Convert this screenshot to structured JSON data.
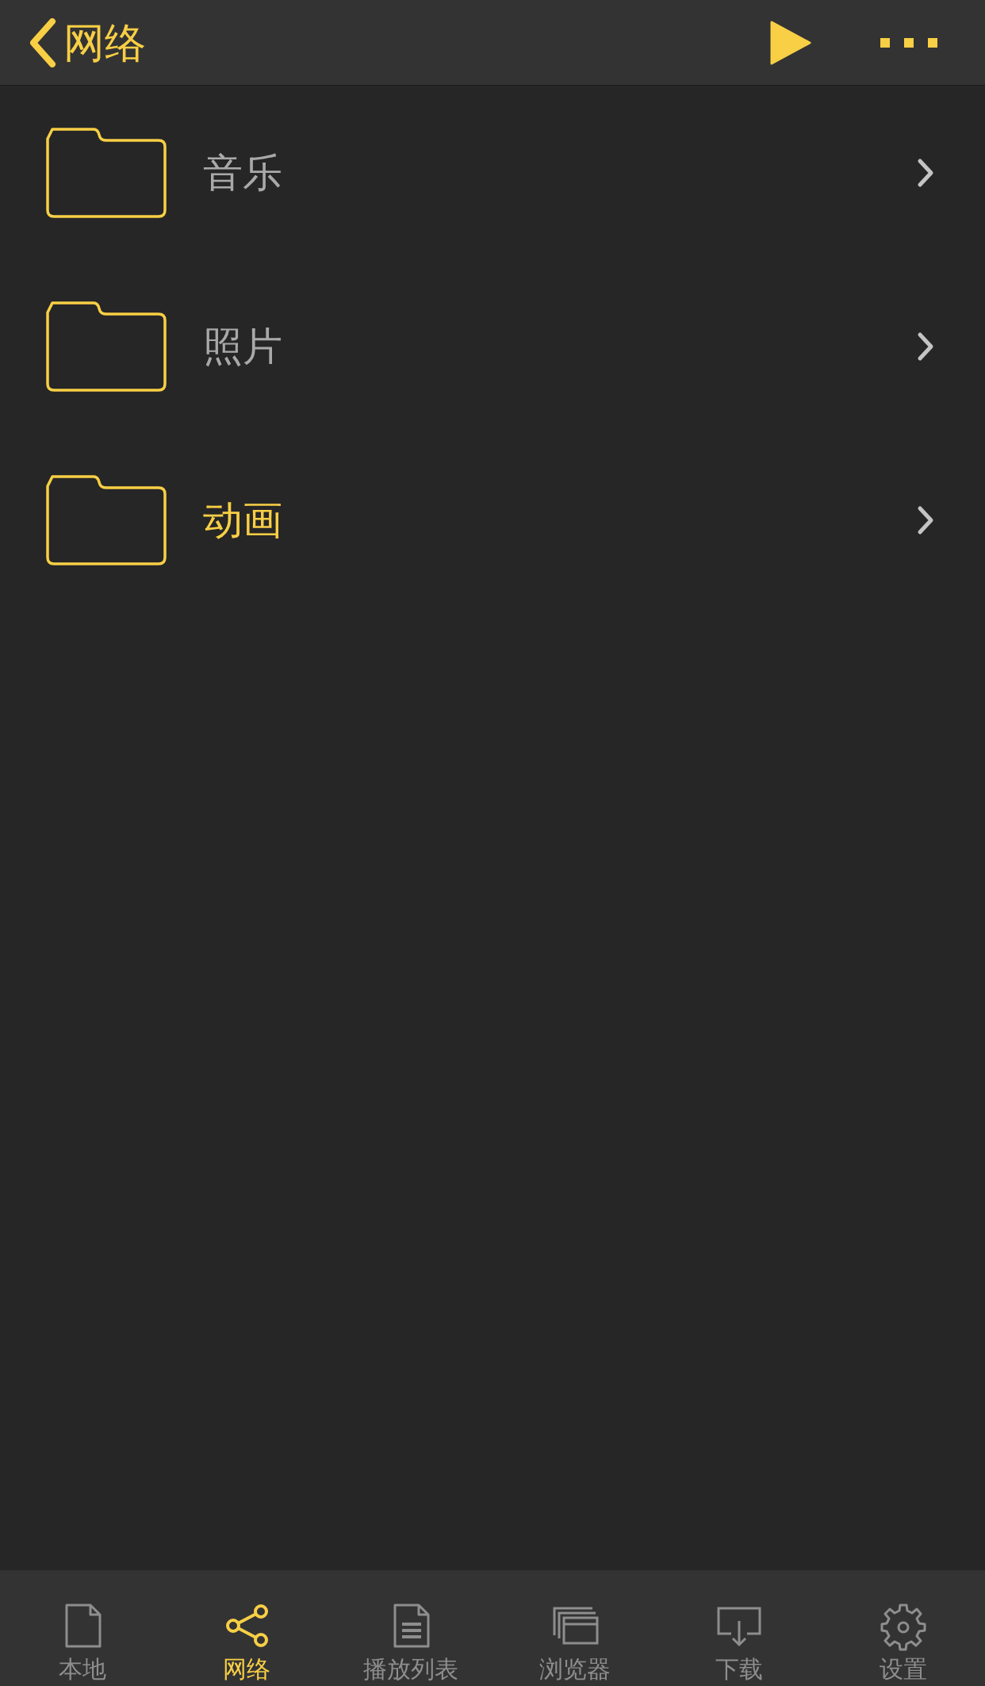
{
  "nav_bar": {
    "back_label": "网络"
  },
  "folders": [
    {
      "name": "音乐",
      "selected": false
    },
    {
      "name": "照片",
      "selected": false
    },
    {
      "name": "动画",
      "selected": true
    }
  ],
  "tab_bar": [
    {
      "kind": "local",
      "label": "本地",
      "selected": false
    },
    {
      "kind": "network",
      "label": "网络",
      "selected": true
    },
    {
      "kind": "playlist",
      "label": "播放列表",
      "selected": false
    },
    {
      "kind": "browser",
      "label": "浏览器",
      "selected": false
    },
    {
      "kind": "download",
      "label": "下载",
      "selected": false
    },
    {
      "kind": "settings",
      "label": "设置",
      "selected": false
    }
  ]
}
